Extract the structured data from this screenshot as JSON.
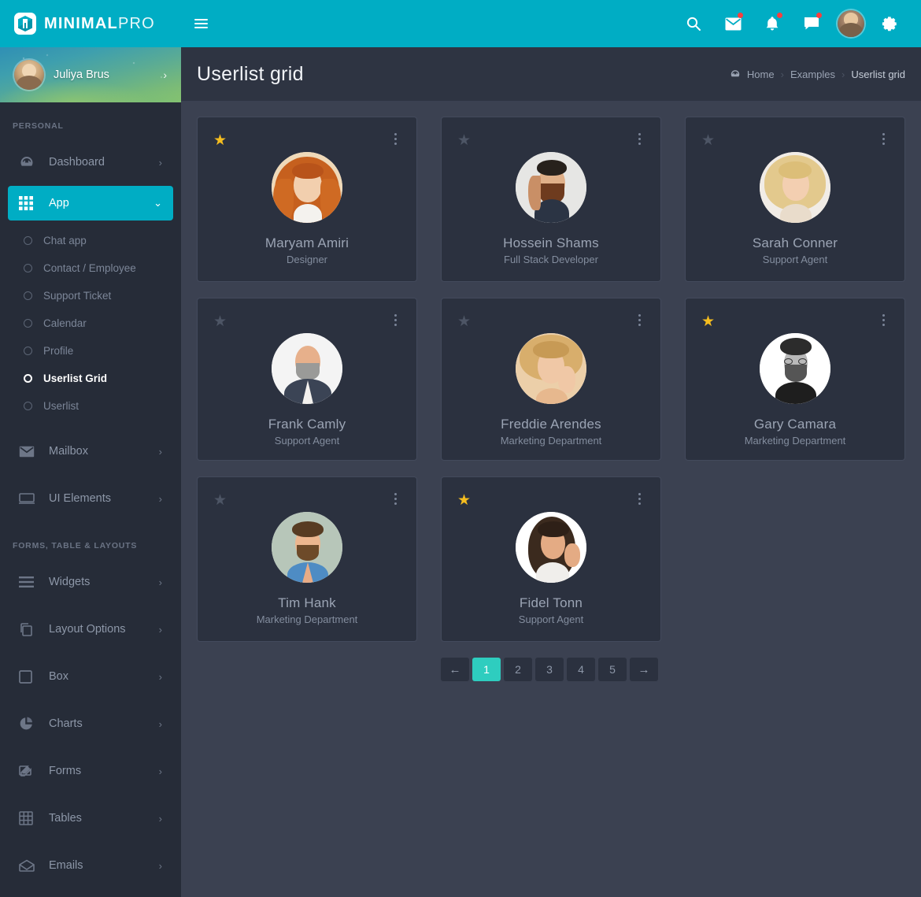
{
  "brand": {
    "bold": "MINIMAL",
    "light": "PRO",
    "logo_icon": "cube-logo-icon"
  },
  "topbar": {
    "menu_toggle": "hamburger-icon",
    "actions": [
      {
        "name": "search",
        "icon": "search-icon",
        "badge": false
      },
      {
        "name": "messages",
        "icon": "envelope-icon",
        "badge": true
      },
      {
        "name": "notifications",
        "icon": "bell-icon",
        "badge": true
      },
      {
        "name": "chat",
        "icon": "chat-bubble-icon",
        "badge": true
      }
    ],
    "avatar_alt": "user-avatar",
    "settings_icon": "gear-icon",
    "bg_color": "#00adc4",
    "badge_color": "#fa3e3e"
  },
  "sidebar": {
    "profile": {
      "name": "Juliya Brus",
      "arrow": "›"
    },
    "sections": [
      {
        "title": "PERSONAL",
        "items": [
          {
            "label": "Dashboard",
            "icon": "gauge-icon",
            "caret": "›",
            "active": false
          },
          {
            "label": "App",
            "icon": "grid-icon",
            "caret": "⌄",
            "active": true
          },
          {
            "label": "Mailbox",
            "icon": "envelope-icon",
            "caret": "›",
            "active": false
          },
          {
            "label": "UI Elements",
            "icon": "window-icon",
            "caret": "›",
            "active": false
          }
        ]
      },
      {
        "title": "FORMS, TABLE & LAYOUTS",
        "items": [
          {
            "label": "Widgets",
            "icon": "list-icon",
            "caret": "›",
            "active": false
          },
          {
            "label": "Layout Options",
            "icon": "copy-icon",
            "caret": "›",
            "active": false
          },
          {
            "label": "Box",
            "icon": "square-icon",
            "caret": "›",
            "active": false
          },
          {
            "label": "Charts",
            "icon": "pie-chart-icon",
            "caret": "›",
            "active": false
          },
          {
            "label": "Forms",
            "icon": "pencil-square-icon",
            "caret": "›",
            "active": false
          },
          {
            "label": "Tables",
            "icon": "table-icon",
            "caret": "›",
            "active": false
          },
          {
            "label": "Emails",
            "icon": "open-envelope-icon",
            "caret": "›",
            "active": false
          }
        ]
      }
    ],
    "submenu": [
      {
        "label": "Chat app",
        "active": false
      },
      {
        "label": "Contact / Employee",
        "active": false
      },
      {
        "label": "Support Ticket",
        "active": false
      },
      {
        "label": "Calendar",
        "active": false
      },
      {
        "label": "Profile",
        "active": false
      },
      {
        "label": "Userlist Grid",
        "active": true
      },
      {
        "label": "Userlist",
        "active": false
      }
    ],
    "bg_color": "#262c38",
    "active_color": "#00adc4"
  },
  "page": {
    "title": "Userlist grid",
    "breadcrumb": {
      "home_icon": "dashboard-icon",
      "items": [
        "Home",
        "Examples",
        "Userlist grid"
      ],
      "separator": "›"
    }
  },
  "users": [
    {
      "name": "Maryam Amiri",
      "role": "Designer",
      "starred": true,
      "avatar": "woman-red-hair"
    },
    {
      "name": "Hossein Shams",
      "role": "Full Stack Developer",
      "starred": false,
      "avatar": "man-beard"
    },
    {
      "name": "Sarah Conner",
      "role": "Support Agent",
      "starred": false,
      "avatar": "woman-blonde"
    },
    {
      "name": "Frank Camly",
      "role": "Support Agent",
      "starred": false,
      "avatar": "man-bald-suit"
    },
    {
      "name": "Freddie Arendes",
      "role": "Marketing Department",
      "starred": false,
      "avatar": "woman-blonde-hand"
    },
    {
      "name": "Gary Camara",
      "role": "Marketing Department",
      "starred": true,
      "avatar": "man-glasses-bw"
    },
    {
      "name": "Tim Hank",
      "role": "Marketing Department",
      "starred": false,
      "avatar": "man-blue-shirt"
    },
    {
      "name": "Fidel Tonn",
      "role": "Support Agent",
      "starred": true,
      "avatar": "woman-brunette"
    }
  ],
  "card": {
    "star_on": "★",
    "star_off": "★",
    "menu_icon": "more-vertical-icon",
    "star_on_color": "#f5bd1f",
    "star_off_color": "#4d5565"
  },
  "pagination": {
    "prev": "←",
    "next": "→",
    "pages": [
      "1",
      "2",
      "3",
      "4",
      "5"
    ],
    "active_page": "1",
    "active_color": "#2ecdbf"
  }
}
